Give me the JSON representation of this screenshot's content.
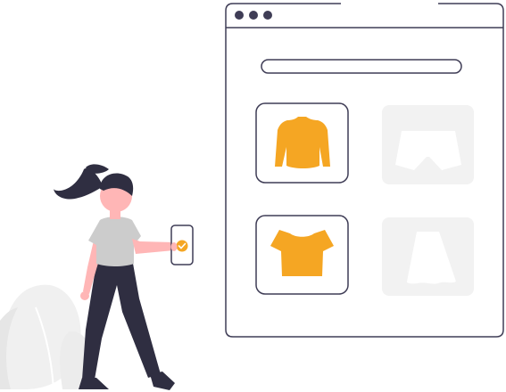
{
  "window": {
    "controls": [
      "close-dot",
      "minimize-dot",
      "maximize-dot"
    ],
    "search_bar": {
      "placeholder": ""
    }
  },
  "products": [
    {
      "icon": "sweater-icon",
      "selected": true
    },
    {
      "icon": "shorts-icon",
      "selected": false
    },
    {
      "icon": "crop-top-icon",
      "selected": true
    },
    {
      "icon": "skirt-icon",
      "selected": false
    }
  ],
  "phone": {
    "status": "check-icon"
  },
  "colors": {
    "accent": "#f5a623",
    "ink": "#2f2e41",
    "outline": "#3f3d56",
    "muted_tile": "#f2f2f2",
    "shirt": "#cccccc",
    "skin": "#ffb6b6",
    "plant": "#f0f0f0"
  }
}
